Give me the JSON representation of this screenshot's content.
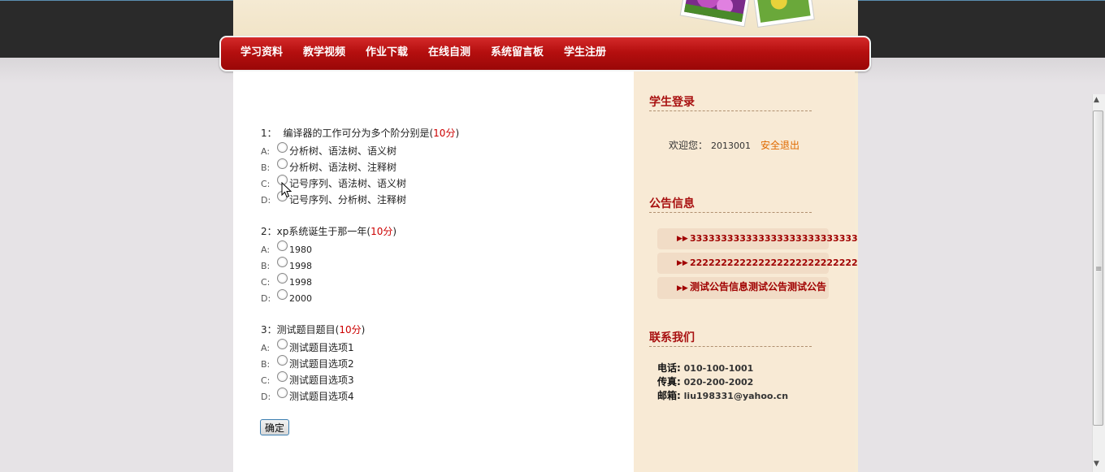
{
  "nav": {
    "items": [
      "学习资料",
      "教学视频",
      "作业下载",
      "在线自测",
      "系统留言板",
      "学生注册"
    ]
  },
  "quiz": {
    "questions": [
      {
        "number": "1：",
        "text": "编译器的工作可分为多个阶分别是",
        "score": "10分",
        "options": [
          {
            "letter": "A:",
            "text": "分析树、语法树、语义树"
          },
          {
            "letter": "B:",
            "text": "分析树、语法树、注释树"
          },
          {
            "letter": "C:",
            "text": "记号序列、语法树、语义树"
          },
          {
            "letter": "D:",
            "text": "记号序列、分析树、注释树"
          }
        ]
      },
      {
        "number": "2：",
        "text": "xp系统诞生于那一年",
        "score": "10分",
        "options": [
          {
            "letter": "A:",
            "text": "1980"
          },
          {
            "letter": "B:",
            "text": "1998"
          },
          {
            "letter": "C:",
            "text": "1998"
          },
          {
            "letter": "D:",
            "text": "2000"
          }
        ]
      },
      {
        "number": "3：",
        "text": "测试题目题目",
        "score": "10分",
        "options": [
          {
            "letter": "A:",
            "text": "测试题目选项1"
          },
          {
            "letter": "B:",
            "text": "测试题目选项2"
          },
          {
            "letter": "C:",
            "text": "测试题目选项3"
          },
          {
            "letter": "D:",
            "text": "测试题目选项4"
          }
        ]
      }
    ],
    "submit_label": "确定"
  },
  "sidebar": {
    "login_title": "学生登录",
    "welcome_label": "欢迎您：",
    "user_id": "2013001",
    "logout_label": "安全退出",
    "notice_title": "公告信息",
    "notices": [
      "333333333333333333333333333",
      "222222222222222222222222222",
      "测试公告信息测试公告测试公告"
    ],
    "contact_title": "联系我们",
    "contact": {
      "phone_label": "电话:",
      "phone": "010-100-1001",
      "fax_label": "传真:",
      "fax": "020-200-2002",
      "email_label": "邮箱:",
      "email": "liu198331@yahoo.cn"
    }
  },
  "colors": {
    "nav_red": "#b50f0f",
    "score_red": "#cc0000",
    "sidebar_bg": "#f8ead5",
    "logout_orange": "#e06a00"
  }
}
